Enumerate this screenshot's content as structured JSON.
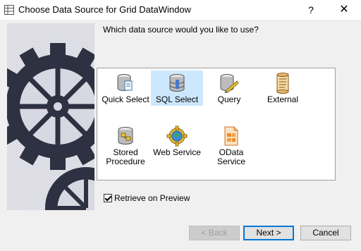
{
  "window": {
    "title": "Choose Data Source for Grid DataWindow",
    "help_label": "?",
    "close_label": "✕"
  },
  "prompt": "Which data source would you like to use?",
  "sources": [
    {
      "label": "Quick Select",
      "icon": "quick-select-db-icon",
      "selected": false
    },
    {
      "label": "SQL Select",
      "icon": "sql-select-db-icon",
      "selected": true
    },
    {
      "label": "Query",
      "icon": "query-db-icon",
      "selected": false
    },
    {
      "label": "External",
      "icon": "external-scroll-icon",
      "selected": false
    },
    {
      "label_line1": "Stored",
      "label_line2": "Procedure",
      "icon": "stored-procedure-icon",
      "selected": false
    },
    {
      "label": "Web Service",
      "icon": "web-service-icon",
      "selected": false
    },
    {
      "label": "OData Service",
      "icon": "odata-service-icon",
      "selected": false
    }
  ],
  "retrieve": {
    "label": "Retrieve on Preview",
    "checked": true
  },
  "buttons": {
    "back": "< Back",
    "next": "Next >",
    "cancel": "Cancel"
  },
  "colors": {
    "selection": "#cce8ff",
    "default_button_border": "#0078d7"
  }
}
